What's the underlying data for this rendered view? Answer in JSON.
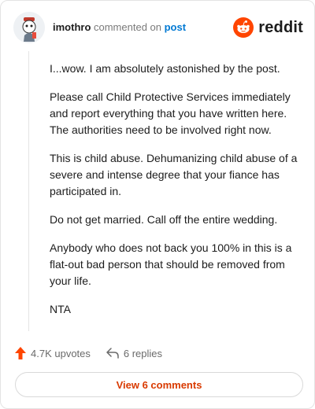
{
  "header": {
    "username": "imothro",
    "action_text": " commented on ",
    "link_text": "post",
    "brand": "reddit"
  },
  "comment": {
    "paragraphs": [
      "I...wow. I am absolutely astonished by the post.",
      "Please call Child Protective Services immediately and report everything that you have written here. The authorities need to be involved right now.",
      "This is child abuse. Dehumanizing child abuse of a severe and intense degree that your fiance has participated in.",
      "Do not get married. Call off the entire wedding.",
      "Anybody who does not back you 100% in this is a flat-out bad person that should be removed from your life.",
      "NTA"
    ]
  },
  "actions": {
    "upvotes": "4.7K upvotes",
    "replies": "6 replies",
    "view_comments": "View 6 comments"
  },
  "colors": {
    "accent": "#ff4500",
    "link": "#0079d3",
    "view_button_text": "#d93a00"
  },
  "icons": {
    "upvote": "upvote-arrow-icon",
    "reply": "reply-arrow-icon",
    "brand": "reddit-snoo-icon"
  }
}
